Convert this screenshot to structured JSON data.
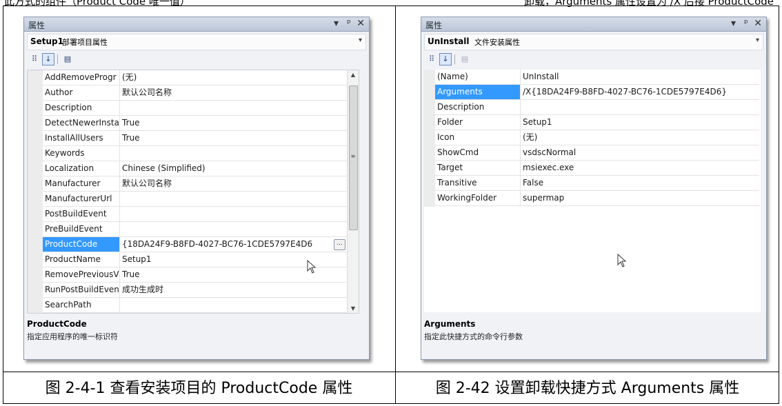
{
  "top_fragments": [
    "此方式的组件（Product Code 唯一值）",
    "卸载，Arguments 属性设置为 /X 后接 ProductCode"
  ],
  "left": {
    "window_title": "属性",
    "object_name": "Setup1",
    "object_type": "部署项目属性",
    "rows": [
      {
        "name": "AddRemoveProgr",
        "value": "(无)"
      },
      {
        "name": "Author",
        "value": "默认公司名称"
      },
      {
        "name": "Description",
        "value": ""
      },
      {
        "name": "DetectNewerInsta",
        "value": "True"
      },
      {
        "name": "InstallAllUsers",
        "value": "True"
      },
      {
        "name": "Keywords",
        "value": ""
      },
      {
        "name": "Localization",
        "value": "Chinese (Simplified)"
      },
      {
        "name": "Manufacturer",
        "value": "默认公司名称"
      },
      {
        "name": "ManufacturerUrl",
        "value": ""
      },
      {
        "name": "PostBuildEvent",
        "value": ""
      },
      {
        "name": "PreBuildEvent",
        "value": ""
      },
      {
        "name": "ProductCode",
        "value": "{18DA24F9-B8FD-4027-BC76-1CDE5797E4D6"
      },
      {
        "name": "ProductName",
        "value": "Setup1"
      },
      {
        "name": "RemovePreviousV",
        "value": "True"
      },
      {
        "name": "RunPostBuildEven",
        "value": "成功生成时"
      },
      {
        "name": "SearchPath",
        "value": ""
      }
    ],
    "description_title": "ProductCode",
    "description_text": "指定应用程序的唯一标识符"
  },
  "right": {
    "window_title": "属性",
    "object_name": "UnInstall",
    "object_type": "文件安装属性",
    "rows": [
      {
        "name": "(Name)",
        "value": "UnInstall"
      },
      {
        "name": "Arguments",
        "value": "/X{18DA24F9-B8FD-4027-BC76-1CDE5797E4D6}"
      },
      {
        "name": "Description",
        "value": ""
      },
      {
        "name": "Folder",
        "value": "Setup1"
      },
      {
        "name": "Icon",
        "value": "(无)"
      },
      {
        "name": "ShowCmd",
        "value": "vsdscNormal"
      },
      {
        "name": "Target",
        "value": "msiexec.exe"
      },
      {
        "name": "Transitive",
        "value": "False"
      },
      {
        "name": "WorkingFolder",
        "value": "supermap"
      }
    ],
    "description_title": "Arguments",
    "description_text": "指定此快捷方式的命令行参数"
  },
  "captions": {
    "left": "图 2-4-1 查看安装项目的 ProductCode 属性",
    "right": "图 2-42 设置卸载快捷方式 Arguments 属性"
  },
  "controls": {
    "dropdown": "▾",
    "pin": "ᵖ",
    "close": "✕",
    "ellipsis": "..."
  }
}
